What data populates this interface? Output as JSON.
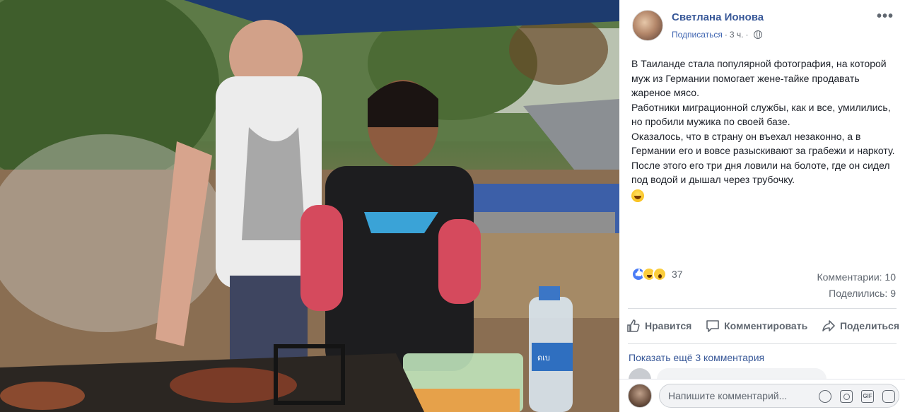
{
  "post": {
    "author": "Светлана Ионова",
    "subscribe_label": "Подписаться",
    "separator": "·",
    "time": "3 ч.",
    "privacy_icon": "globe-icon",
    "more_icon": "more-icon",
    "text_lines": [
      "В Таиланде стала популярной фотография, на которой муж из Германии помогает жене-тайке продавать жареное мясо.",
      "Работники миграционной службы, как и все, умилились, но пробили мужика по своей базе.",
      "Оказалось, что в страну он въехал незаконно, а в Германии его и вовсе разыскивают за грабежи и наркоту.",
      "После этого его три дня ловили на болоте, где он сидел под водой и дышал через трубочку."
    ],
    "trailing_emoji": "grinning-emoji"
  },
  "reactions": {
    "types": [
      "like",
      "haha",
      "wow"
    ],
    "count": "37"
  },
  "stats": {
    "comments": "Комментарии: 10",
    "shares": "Поделились: 9"
  },
  "actions": {
    "like": "Нравится",
    "comment": "Комментировать",
    "share": "Поделиться"
  },
  "comments": {
    "show_more": "Показать ещё 3 комментария"
  },
  "composer": {
    "placeholder": "Напишите комментарий...",
    "icons": [
      "emoji-icon",
      "camera-icon",
      "gif-icon",
      "sticker-icon"
    ]
  },
  "photo": {
    "bottle_label": "ดเบ"
  }
}
